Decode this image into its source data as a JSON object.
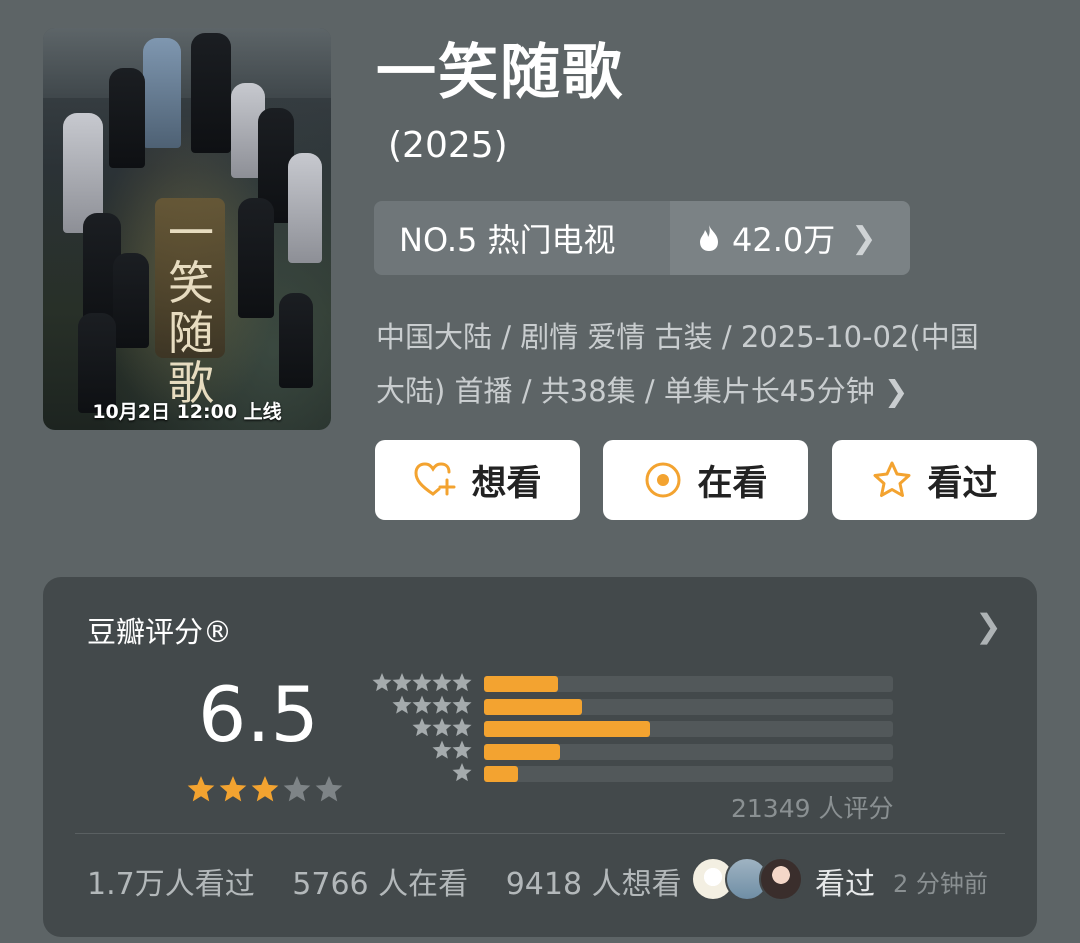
{
  "poster": {
    "release_text": "10月2日 12:00 上线",
    "calligraphy": "一笑随歌"
  },
  "title": "一笑随歌",
  "year": "(2025)",
  "ranking": {
    "label": "NO.5 热门电视",
    "heat": "42.0万"
  },
  "meta": {
    "line1": "中国大陆 / 剧情 爱情 古装 / 2025-10-02(中国",
    "line2": "大陆) 首播 / 共38集 / 单集片长45分钟"
  },
  "actions": {
    "want": "想看",
    "watching": "在看",
    "watched": "看过"
  },
  "rating": {
    "label": "豆瓣评分®",
    "score": "6.5",
    "score_stars": 3,
    "distribution_percent": [
      16.5,
      21.8,
      36.9,
      16.8,
      7.6
    ],
    "distribution_labels": [
      "5星",
      "4星",
      "3星",
      "2星",
      "1星"
    ],
    "count_text": "21349 人评分"
  },
  "stats": {
    "watched": "1.7万人看过",
    "watching": "5766 人在看",
    "want": "9418 人想看"
  },
  "friend_activity": {
    "action": "看过",
    "time": "2 分钟前"
  },
  "colors": {
    "accent": "#f3a330",
    "background": "#5d6466",
    "card": "#43494b"
  },
  "icons": [
    "heart-plus-icon",
    "target-icon",
    "star-outline-icon",
    "flame-icon",
    "chevron-right-icon",
    "star-icon"
  ]
}
